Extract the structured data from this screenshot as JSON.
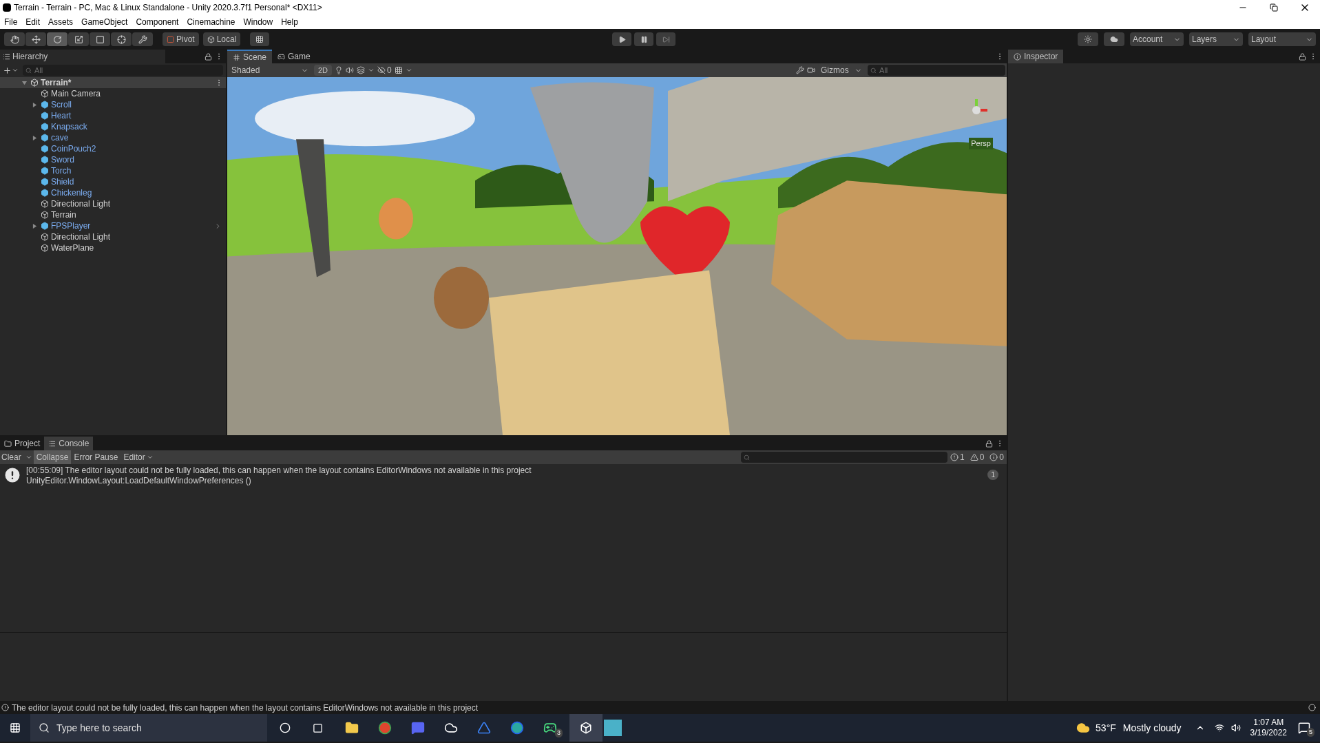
{
  "window": {
    "title": "Terrain - Terrain - PC, Mac & Linux Standalone - Unity 2020.3.7f1 Personal* <DX11>"
  },
  "menu": [
    "File",
    "Edit",
    "Assets",
    "GameObject",
    "Component",
    "Cinemachine",
    "Window",
    "Help"
  ],
  "toolbar": {
    "tools": [
      {
        "kind": "hand",
        "selected": false
      },
      {
        "kind": "move",
        "selected": false
      },
      {
        "kind": "rotate",
        "selected": true
      },
      {
        "kind": "scale",
        "selected": false
      },
      {
        "kind": "rect",
        "selected": false
      },
      {
        "kind": "transform",
        "selected": false
      },
      {
        "kind": "custom",
        "selected": false
      }
    ],
    "pivot": "Pivot",
    "space": "Local",
    "account": "Account",
    "layers": "Layers",
    "layout": "Layout"
  },
  "hierarchy": {
    "title": "Hierarchy",
    "search": {
      "placeholder": "All"
    },
    "scene": {
      "name": "Terrain*",
      "expanded": true,
      "children": [
        {
          "name": "Main Camera",
          "kind": "object",
          "expandable": false
        },
        {
          "name": "Scroll",
          "kind": "prefab",
          "expandable": true
        },
        {
          "name": "Heart",
          "kind": "prefab",
          "expandable": false
        },
        {
          "name": "Knapsack",
          "kind": "prefab",
          "expandable": false
        },
        {
          "name": "cave",
          "kind": "prefab",
          "expandable": true
        },
        {
          "name": "CoinPouch2",
          "kind": "prefab",
          "expandable": false
        },
        {
          "name": "Sword",
          "kind": "prefab",
          "expandable": false
        },
        {
          "name": "Torch",
          "kind": "prefab",
          "expandable": false
        },
        {
          "name": "Shield",
          "kind": "prefab",
          "expandable": false
        },
        {
          "name": "Chickenleg",
          "kind": "prefab",
          "expandable": false
        },
        {
          "name": "Directional Light",
          "kind": "object",
          "expandable": false
        },
        {
          "name": "Terrain",
          "kind": "object",
          "expandable": false
        },
        {
          "name": "FPSPlayer",
          "kind": "prefab",
          "expandable": true
        },
        {
          "name": "Directional Light",
          "kind": "object",
          "expandable": false
        },
        {
          "name": "WaterPlane",
          "kind": "object",
          "expandable": false
        }
      ]
    }
  },
  "scene_view": {
    "tabs": [
      {
        "label": "Scene",
        "kind": "scene",
        "selected": true
      },
      {
        "label": "Game",
        "kind": "game",
        "selected": false
      }
    ],
    "draw_mode": "Shaded",
    "mode_2d": "2D",
    "hidden_count": "0",
    "gizmos": "Gizmos",
    "search": {
      "placeholder": "All"
    },
    "orientation": "Persp"
  },
  "inspector": {
    "title": "Inspector"
  },
  "bottom": {
    "tabs": [
      {
        "label": "Project",
        "kind": "project",
        "selected": false
      },
      {
        "label": "Console",
        "kind": "console",
        "selected": true
      }
    ],
    "clear": "Clear",
    "collapse": {
      "label": "Collapse",
      "on": true
    },
    "error_pause": {
      "label": "Error Pause",
      "on": false
    },
    "editor": "Editor",
    "counts": [
      {
        "kind": "error",
        "count": "1"
      },
      {
        "kind": "warning",
        "count": "0"
      },
      {
        "kind": "info",
        "count": "0"
      }
    ],
    "logs": [
      {
        "line_1": "[00:55:09] The editor layout could not be fully loaded, this can happen when the layout contains EditorWindows not available in this project",
        "line_2": "UnityEditor.WindowLayout:LoadDefaultWindowPreferences ()",
        "count": "1"
      }
    ]
  },
  "status_bar": "The editor layout could not be fully loaded, this can happen when the layout contains EditorWindows not available in this project",
  "taskbar": {
    "search": {
      "placeholder": "Type here to search"
    },
    "xbox_badge": "3",
    "temperature": "53°F",
    "weather": "Mostly cloudy",
    "time": "1:07 AM",
    "date": "3/19/2022",
    "notifications": "5"
  }
}
